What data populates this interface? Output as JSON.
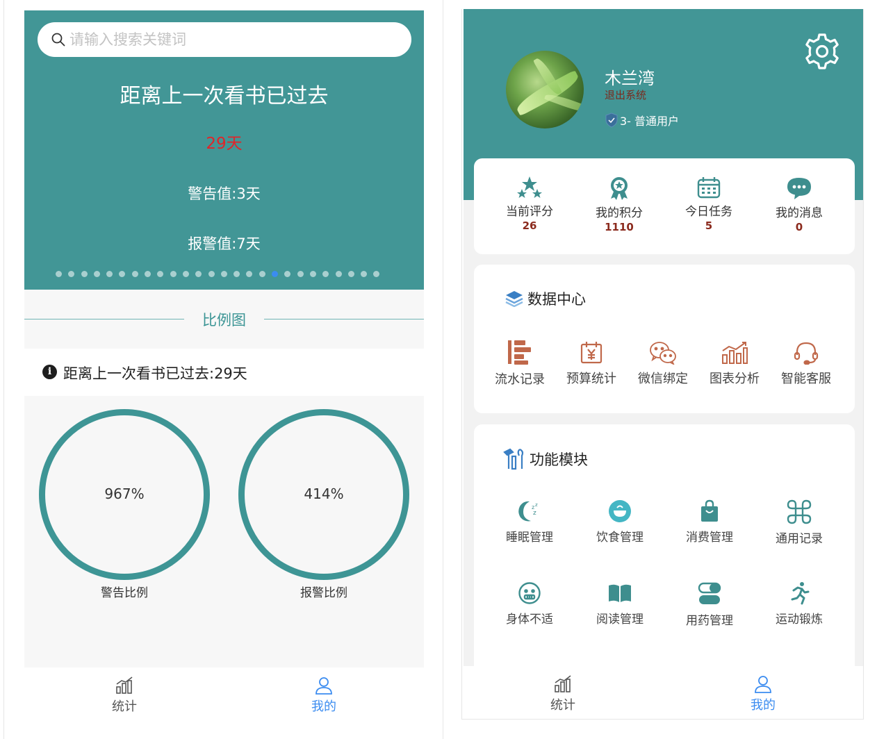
{
  "left": {
    "search": {
      "placeholder": "请输入搜索关键词"
    },
    "banner": {
      "title": "距离上一次看书已过去",
      "days": "29天",
      "warning": "警告值:3天",
      "alarm": "报警值:7天",
      "dot_count": 26,
      "active_dot": 17
    },
    "section_title": "比例图",
    "notice": "距离上一次看书已过去:29天",
    "gauges": [
      {
        "value": "967%",
        "label": "警告比例"
      },
      {
        "value": "414%",
        "label": "报警比例"
      }
    ],
    "tabbar": [
      {
        "label": "统计",
        "icon": "chart-icon",
        "active": false
      },
      {
        "label": "我的",
        "icon": "user-icon",
        "active": true
      }
    ]
  },
  "right": {
    "profile": {
      "name": "木兰湾",
      "logout": "退出系统",
      "role": "3- 普通用户"
    },
    "stats": [
      {
        "label": "当前评分",
        "value": "26",
        "icon": "stars-icon"
      },
      {
        "label": "我的积分",
        "value": "1110",
        "icon": "medal-icon"
      },
      {
        "label": "今日任务",
        "value": "5",
        "icon": "calendar-icon"
      },
      {
        "label": "我的消息",
        "value": "0",
        "icon": "chat-bubble-icon"
      }
    ],
    "data_center": {
      "title": "数据中心",
      "items": [
        {
          "label": "流水记录",
          "icon": "list-icon"
        },
        {
          "label": "预算统计",
          "icon": "yen-calendar-icon"
        },
        {
          "label": "微信绑定",
          "icon": "wechat-icon"
        },
        {
          "label": "图表分析",
          "icon": "bar-chart-icon"
        },
        {
          "label": "智能客服",
          "icon": "headset-icon"
        }
      ]
    },
    "modules": {
      "title": "功能模块",
      "items": [
        {
          "label": "睡眠管理",
          "icon": "moon-icon"
        },
        {
          "label": "饮食管理",
          "icon": "bowl-icon"
        },
        {
          "label": "消费管理",
          "icon": "shopping-bag-icon"
        },
        {
          "label": "通用记录",
          "icon": "command-icon"
        },
        {
          "label": "身体不适",
          "icon": "sad-face-icon"
        },
        {
          "label": "阅读管理",
          "icon": "book-icon"
        },
        {
          "label": "用药管理",
          "icon": "pill-icon"
        },
        {
          "label": "运动锻炼",
          "icon": "running-icon"
        }
      ]
    },
    "tabbar": [
      {
        "label": "统计",
        "icon": "chart-icon",
        "active": false
      },
      {
        "label": "我的",
        "icon": "user-icon",
        "active": true
      }
    ]
  },
  "colors": {
    "teal": "#429696",
    "accent_blue": "#3b8cf0",
    "red": "#e0252a",
    "brown": "#8b2a1d",
    "icon_brown": "#c0684a"
  }
}
